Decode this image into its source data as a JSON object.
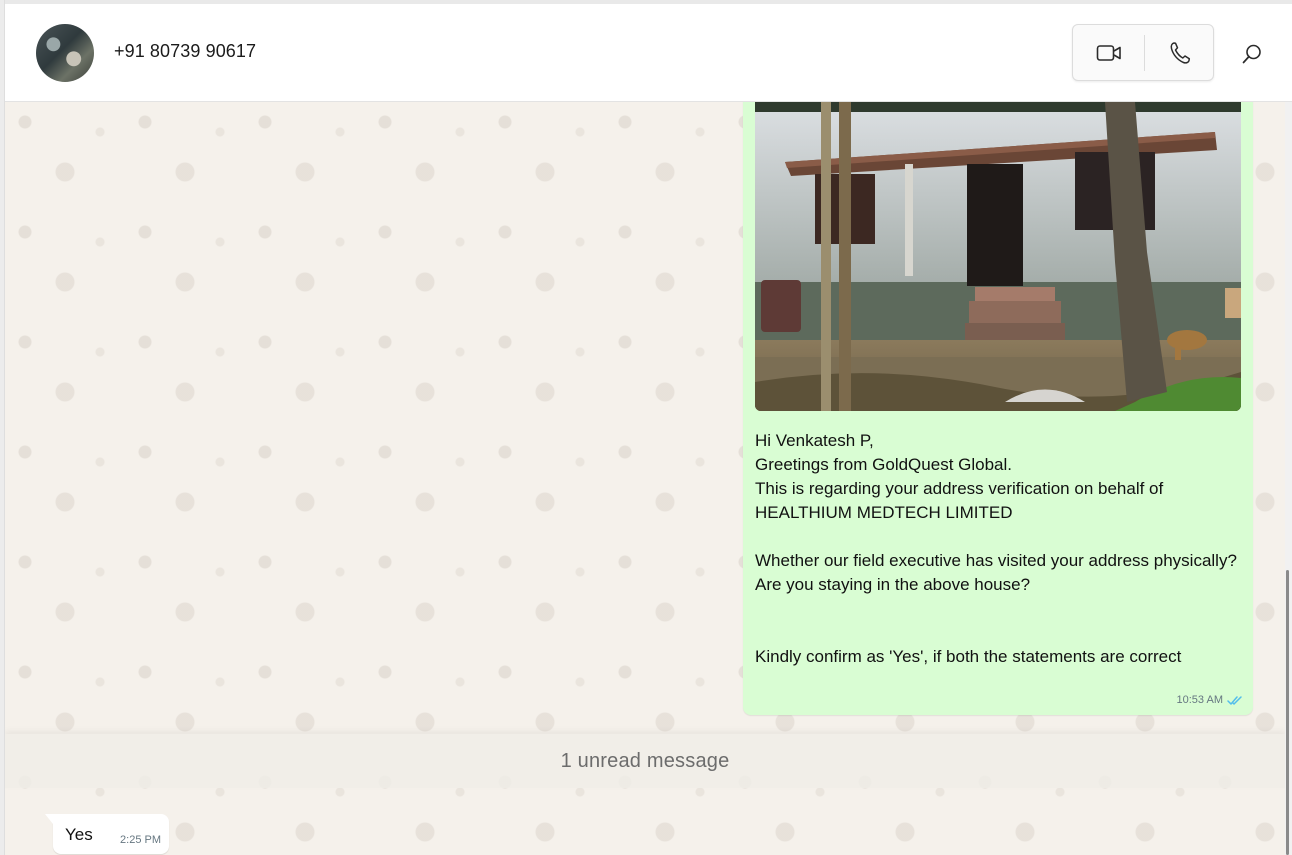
{
  "header": {
    "contact_name": "+91 80739 90617",
    "icons": {
      "avatar": "avatar",
      "video": "video-camera-icon",
      "voice": "phone-icon",
      "search": "search-icon"
    }
  },
  "chat": {
    "outgoing_message": {
      "text": "Hi Venkatesh P,\nGreetings from GoldQuest Global.\nThis is regarding your address verification on behalf of HEALTHIUM MEDTECH LIMITED\n\nWhether our field executive has visited your address physically?\nAre you staying in the above house?\n\n\nKindly confirm as 'Yes', if both the statements are correct",
      "time": "10:53 AM",
      "status_icon": "double-check-read-icon"
    },
    "unread_divider": "1 unread message",
    "incoming_message": {
      "text": "Yes",
      "time": "2:25 PM"
    }
  },
  "colors": {
    "outgoing_bubble": "#d9fdd3",
    "read_tick": "#53bdeb",
    "chat_bg": "#f5f1eb"
  }
}
